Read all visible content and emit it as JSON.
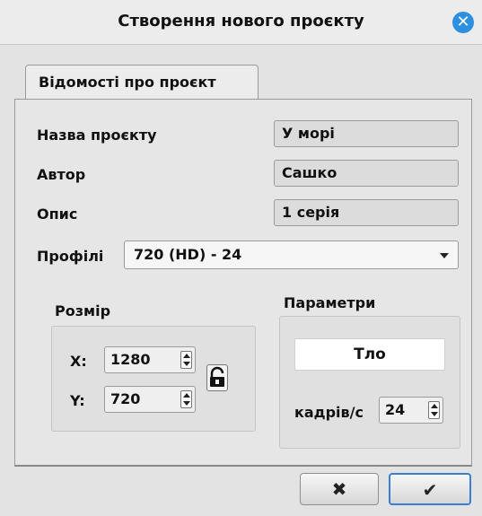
{
  "window": {
    "title": "Створення нового проєкту",
    "close_icon": "close-icon"
  },
  "tabs": [
    {
      "label": "Відомості про проєкт",
      "active": true
    }
  ],
  "fields": {
    "name": {
      "label": "Назва проєкту",
      "value": "У морі"
    },
    "author": {
      "label": "Автор",
      "value": "Сашко"
    },
    "description": {
      "label": "Опис",
      "value": "1 серія"
    },
    "profiles": {
      "label": "Профілі",
      "value": "720 (HD) - 24"
    }
  },
  "size": {
    "title": "Розмір",
    "x_label": "X:",
    "x_value": "1280",
    "y_label": "Y:",
    "y_value": "720",
    "lock_icon": "lock-icon"
  },
  "parameters": {
    "title": "Параметри",
    "background_button": "Тло",
    "fps_label": "кадрів/с",
    "fps_value": "24"
  },
  "footer": {
    "cancel_icon": "✖",
    "ok_icon": "✔"
  },
  "colors": {
    "accent": "#2d8fdf",
    "dialog_bg": "#e3e3e3"
  }
}
